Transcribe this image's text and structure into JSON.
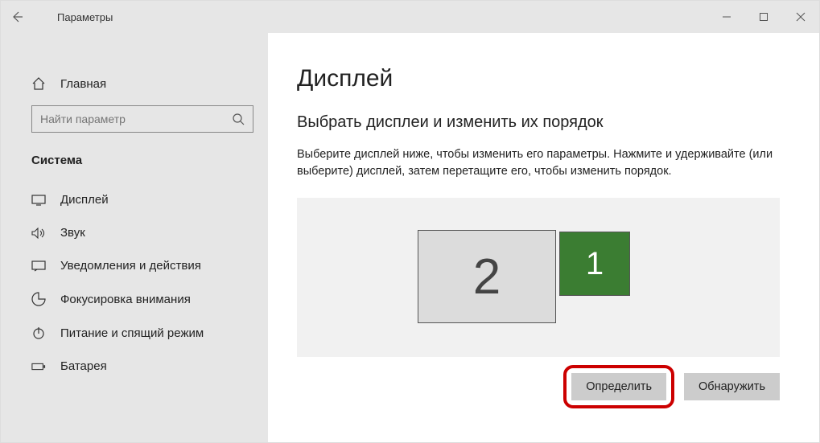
{
  "title": "Параметры",
  "home": "Главная",
  "search": {
    "placeholder": "Найти параметр"
  },
  "section": "Система",
  "nav": {
    "display": "Дисплей",
    "sound": "Звук",
    "notifications": "Уведомления и действия",
    "focus": "Фокусировка внимания",
    "power": "Питание и спящий режим",
    "battery": "Батарея"
  },
  "main": {
    "heading": "Дисплей",
    "subheading": "Выбрать дисплеи и изменить их порядок",
    "description": "Выберите дисплей ниже, чтобы изменить его параметры. Нажмите и удерживайте (или выберите) дисплей, затем перетащите его, чтобы изменить порядок.",
    "monitor1": "1",
    "monitor2": "2",
    "identify": "Определить",
    "detect": "Обнаружить"
  }
}
